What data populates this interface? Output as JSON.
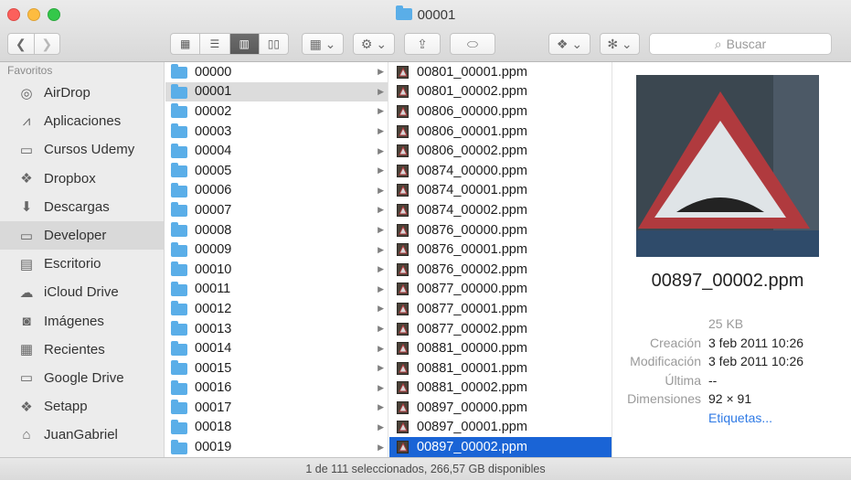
{
  "window": {
    "title": "00001"
  },
  "toolbar": {
    "search_placeholder": "Buscar",
    "back_icon": "chevron-left-icon",
    "forward_icon": "chevron-right-icon"
  },
  "sidebar": {
    "header": "Favoritos",
    "items": [
      {
        "label": "AirDrop",
        "icon": "airdrop-icon",
        "glyph": "◎"
      },
      {
        "label": "Aplicaciones",
        "icon": "applications-icon",
        "glyph": "⩘"
      },
      {
        "label": "Cursos Udemy",
        "icon": "folder-icon",
        "glyph": "▭"
      },
      {
        "label": "Dropbox",
        "icon": "dropbox-icon",
        "glyph": "❖"
      },
      {
        "label": "Descargas",
        "icon": "downloads-icon",
        "glyph": "⬇"
      },
      {
        "label": "Developer",
        "icon": "folder-icon",
        "glyph": "▭",
        "active": true
      },
      {
        "label": "Escritorio",
        "icon": "desktop-icon",
        "glyph": "▤"
      },
      {
        "label": "iCloud Drive",
        "icon": "cloud-icon",
        "glyph": "☁"
      },
      {
        "label": "Imágenes",
        "icon": "camera-icon",
        "glyph": "◙"
      },
      {
        "label": "Recientes",
        "icon": "recents-icon",
        "glyph": "▦"
      },
      {
        "label": "Google Drive",
        "icon": "folder-icon",
        "glyph": "▭"
      },
      {
        "label": "Setapp",
        "icon": "setapp-icon",
        "glyph": "❖"
      },
      {
        "label": "JuanGabriel",
        "icon": "home-icon",
        "glyph": "⌂"
      }
    ]
  },
  "column1": {
    "selected_index": 1,
    "items": [
      "00000",
      "00001",
      "00002",
      "00003",
      "00004",
      "00005",
      "00006",
      "00007",
      "00008",
      "00009",
      "00010",
      "00011",
      "00012",
      "00013",
      "00014",
      "00015",
      "00016",
      "00017",
      "00018",
      "00019"
    ]
  },
  "column2": {
    "selected_index": 19,
    "items": [
      "00801_00001.ppm",
      "00801_00002.ppm",
      "00806_00000.ppm",
      "00806_00001.ppm",
      "00806_00002.ppm",
      "00874_00000.ppm",
      "00874_00001.ppm",
      "00874_00002.ppm",
      "00876_00000.ppm",
      "00876_00001.ppm",
      "00876_00002.ppm",
      "00877_00000.ppm",
      "00877_00001.ppm",
      "00877_00002.ppm",
      "00881_00000.ppm",
      "00881_00001.ppm",
      "00881_00002.ppm",
      "00897_00000.ppm",
      "00897_00001.ppm",
      "00897_00002.ppm"
    ]
  },
  "preview": {
    "filename": "00897_00002.ppm",
    "size": "25 KB",
    "created_label": "Creación",
    "created_value": "3 feb 2011 10:26",
    "modified_label": "Modificación",
    "modified_value": "3 feb 2011 10:26",
    "last_label": "Última",
    "last_value": "--",
    "dimensions_label": "Dimensiones",
    "dimensions_value": "92 × 91",
    "tags_link": "Etiquetas..."
  },
  "status": {
    "text": "1 de 111 seleccionados, 266,57 GB disponibles"
  }
}
